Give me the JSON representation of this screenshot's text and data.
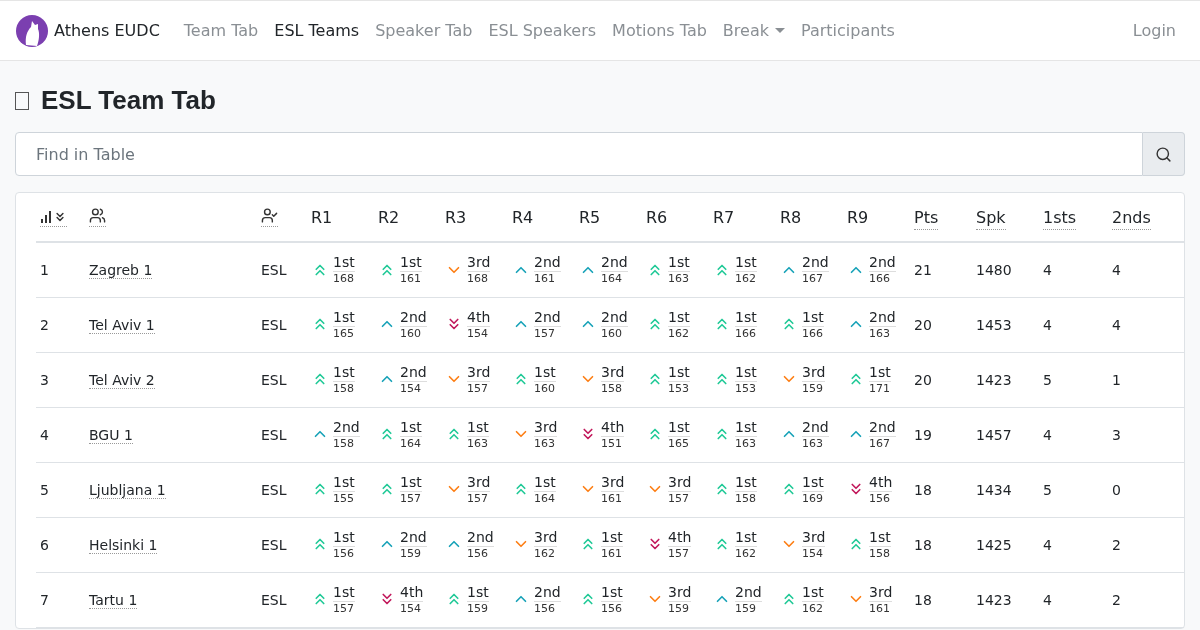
{
  "navbar": {
    "brand": "Athens EUDC",
    "items": [
      {
        "label": "Team Tab",
        "selected": false,
        "kind": "link"
      },
      {
        "label": "ESL Teams",
        "selected": true,
        "kind": "link"
      },
      {
        "label": "Speaker Tab",
        "selected": false,
        "kind": "link"
      },
      {
        "label": "ESL Speakers",
        "selected": false,
        "kind": "link"
      },
      {
        "label": "Motions Tab",
        "selected": false,
        "kind": "link"
      },
      {
        "label": "Break",
        "selected": false,
        "kind": "dropdown"
      },
      {
        "label": "Participants",
        "selected": false,
        "kind": "link"
      }
    ],
    "login": "Login"
  },
  "page_title": "ESL Team Tab",
  "search": {
    "placeholder": "Find in Table"
  },
  "table": {
    "round_columns": [
      "R1",
      "R2",
      "R3",
      "R4",
      "R5",
      "R6",
      "R7",
      "R8",
      "R9"
    ],
    "stat_columns": [
      "Pts",
      "Spk",
      "1sts",
      "2nds"
    ],
    "rows": [
      {
        "rank": "1",
        "team": "Zagreb 1",
        "category": "ESL",
        "results": [
          {
            "kind": "first",
            "place": "1st",
            "score": "168"
          },
          {
            "kind": "first",
            "place": "1st",
            "score": "161"
          },
          {
            "kind": "third",
            "place": "3rd",
            "score": "168"
          },
          {
            "kind": "second",
            "place": "2nd",
            "score": "161"
          },
          {
            "kind": "second",
            "place": "2nd",
            "score": "164"
          },
          {
            "kind": "first",
            "place": "1st",
            "score": "163"
          },
          {
            "kind": "first",
            "place": "1st",
            "score": "162"
          },
          {
            "kind": "second",
            "place": "2nd",
            "score": "167"
          },
          {
            "kind": "second",
            "place": "2nd",
            "score": "166"
          }
        ],
        "stats": [
          "21",
          "1480",
          "4",
          "4"
        ]
      },
      {
        "rank": "2",
        "team": "Tel Aviv 1",
        "category": "ESL",
        "results": [
          {
            "kind": "first",
            "place": "1st",
            "score": "165"
          },
          {
            "kind": "second",
            "place": "2nd",
            "score": "160"
          },
          {
            "kind": "fourth",
            "place": "4th",
            "score": "154"
          },
          {
            "kind": "second",
            "place": "2nd",
            "score": "157"
          },
          {
            "kind": "second",
            "place": "2nd",
            "score": "160"
          },
          {
            "kind": "first",
            "place": "1st",
            "score": "162"
          },
          {
            "kind": "first",
            "place": "1st",
            "score": "166"
          },
          {
            "kind": "first",
            "place": "1st",
            "score": "166"
          },
          {
            "kind": "second",
            "place": "2nd",
            "score": "163"
          }
        ],
        "stats": [
          "20",
          "1453",
          "4",
          "4"
        ]
      },
      {
        "rank": "3",
        "team": "Tel Aviv 2",
        "category": "ESL",
        "results": [
          {
            "kind": "first",
            "place": "1st",
            "score": "158"
          },
          {
            "kind": "second",
            "place": "2nd",
            "score": "154"
          },
          {
            "kind": "third",
            "place": "3rd",
            "score": "157"
          },
          {
            "kind": "first",
            "place": "1st",
            "score": "160"
          },
          {
            "kind": "third",
            "place": "3rd",
            "score": "158"
          },
          {
            "kind": "first",
            "place": "1st",
            "score": "153"
          },
          {
            "kind": "first",
            "place": "1st",
            "score": "153"
          },
          {
            "kind": "third",
            "place": "3rd",
            "score": "159"
          },
          {
            "kind": "first",
            "place": "1st",
            "score": "171"
          }
        ],
        "stats": [
          "20",
          "1423",
          "5",
          "1"
        ]
      },
      {
        "rank": "4",
        "team": "BGU 1",
        "category": "ESL",
        "results": [
          {
            "kind": "second",
            "place": "2nd",
            "score": "158"
          },
          {
            "kind": "first",
            "place": "1st",
            "score": "164"
          },
          {
            "kind": "first",
            "place": "1st",
            "score": "163"
          },
          {
            "kind": "third",
            "place": "3rd",
            "score": "163"
          },
          {
            "kind": "fourth",
            "place": "4th",
            "score": "151"
          },
          {
            "kind": "first",
            "place": "1st",
            "score": "165"
          },
          {
            "kind": "first",
            "place": "1st",
            "score": "163"
          },
          {
            "kind": "second",
            "place": "2nd",
            "score": "163"
          },
          {
            "kind": "second",
            "place": "2nd",
            "score": "167"
          }
        ],
        "stats": [
          "19",
          "1457",
          "4",
          "3"
        ]
      },
      {
        "rank": "5",
        "team": "Ljubljana 1",
        "category": "ESL",
        "results": [
          {
            "kind": "first",
            "place": "1st",
            "score": "155"
          },
          {
            "kind": "first",
            "place": "1st",
            "score": "157"
          },
          {
            "kind": "third",
            "place": "3rd",
            "score": "157"
          },
          {
            "kind": "first",
            "place": "1st",
            "score": "164"
          },
          {
            "kind": "third",
            "place": "3rd",
            "score": "161"
          },
          {
            "kind": "third",
            "place": "3rd",
            "score": "157"
          },
          {
            "kind": "first",
            "place": "1st",
            "score": "158"
          },
          {
            "kind": "first",
            "place": "1st",
            "score": "169"
          },
          {
            "kind": "fourth",
            "place": "4th",
            "score": "156"
          }
        ],
        "stats": [
          "18",
          "1434",
          "5",
          "0"
        ]
      },
      {
        "rank": "6",
        "team": "Helsinki 1",
        "category": "ESL",
        "results": [
          {
            "kind": "first",
            "place": "1st",
            "score": "156"
          },
          {
            "kind": "second",
            "place": "2nd",
            "score": "159"
          },
          {
            "kind": "second",
            "place": "2nd",
            "score": "156"
          },
          {
            "kind": "third",
            "place": "3rd",
            "score": "162"
          },
          {
            "kind": "first",
            "place": "1st",
            "score": "161"
          },
          {
            "kind": "fourth",
            "place": "4th",
            "score": "157"
          },
          {
            "kind": "first",
            "place": "1st",
            "score": "162"
          },
          {
            "kind": "third",
            "place": "3rd",
            "score": "154"
          },
          {
            "kind": "first",
            "place": "1st",
            "score": "158"
          }
        ],
        "stats": [
          "18",
          "1425",
          "4",
          "2"
        ]
      },
      {
        "rank": "7",
        "team": "Tartu 1",
        "category": "ESL",
        "results": [
          {
            "kind": "first",
            "place": "1st",
            "score": "157"
          },
          {
            "kind": "fourth",
            "place": "4th",
            "score": "154"
          },
          {
            "kind": "first",
            "place": "1st",
            "score": "159"
          },
          {
            "kind": "second",
            "place": "2nd",
            "score": "156"
          },
          {
            "kind": "first",
            "place": "1st",
            "score": "156"
          },
          {
            "kind": "third",
            "place": "3rd",
            "score": "159"
          },
          {
            "kind": "second",
            "place": "2nd",
            "score": "159"
          },
          {
            "kind": "first",
            "place": "1st",
            "score": "162"
          },
          {
            "kind": "third",
            "place": "3rd",
            "score": "161"
          }
        ],
        "stats": [
          "18",
          "1423",
          "4",
          "2"
        ]
      }
    ]
  }
}
